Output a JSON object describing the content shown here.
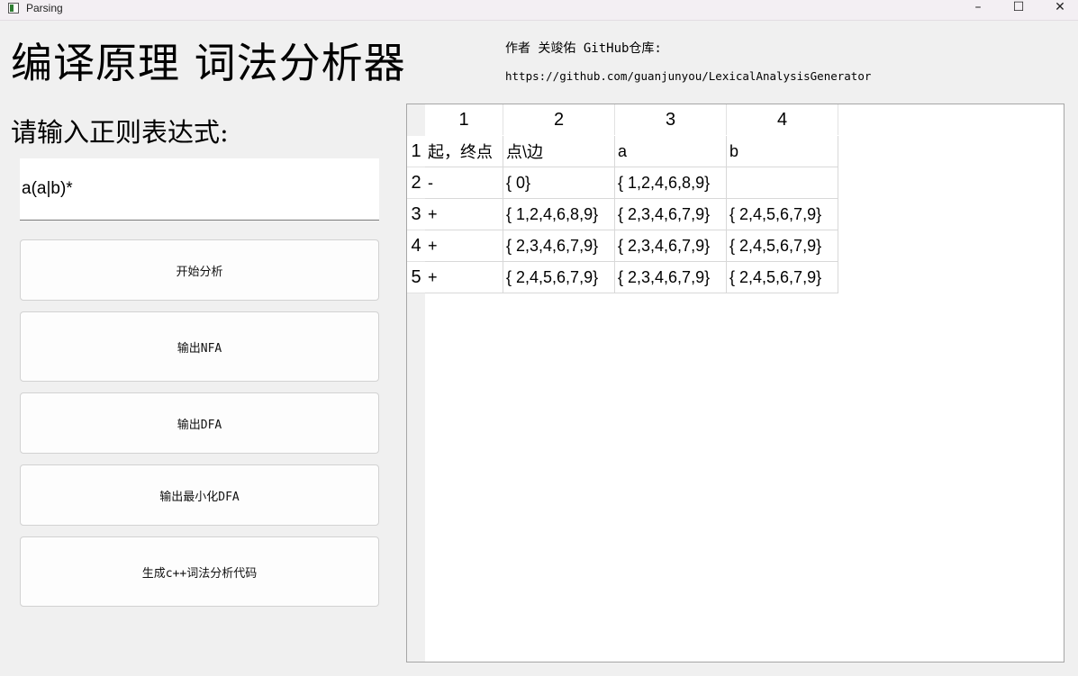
{
  "window": {
    "title": "Parsing",
    "controls": {
      "minimize": "–",
      "maximize": "☐",
      "close": "✕"
    },
    "icon": "app-window-icon"
  },
  "header": {
    "title": "编译原理 词法分析器",
    "author_line": "作者 关竣佑 GitHub仓库:",
    "repo_url": "https://github.com/guanjunyou/LexicalAnalysisGenerator"
  },
  "input": {
    "prompt": "请输入正则表达式:",
    "value": "a(a|b)*"
  },
  "buttons": {
    "analyze": "开始分析",
    "output_nfa": "输出NFA",
    "output_dfa": "输出DFA",
    "output_min_dfa": "输出最小化DFA",
    "generate_code": "生成c++词法分析代码"
  },
  "table": {
    "column_headers": [
      "1",
      "2",
      "3",
      "4"
    ],
    "row_headers": [
      "1",
      "2",
      "3",
      "4",
      "5"
    ],
    "rows": [
      [
        "起，终点",
        "点\\边",
        "a",
        "b"
      ],
      [
        "-",
        "{ 0}",
        "{ 1,2,4,6,8,9}",
        ""
      ],
      [
        "+",
        "{ 1,2,4,6,8,9}",
        "{ 2,3,4,6,7,9}",
        "{ 2,4,5,6,7,9}"
      ],
      [
        "+",
        "{ 2,3,4,6,7,9}",
        "{ 2,3,4,6,7,9}",
        "{ 2,4,5,6,7,9}"
      ],
      [
        "+",
        "{ 2,4,5,6,7,9}",
        "{ 2,3,4,6,7,9}",
        "{ 2,4,5,6,7,9}"
      ]
    ]
  }
}
